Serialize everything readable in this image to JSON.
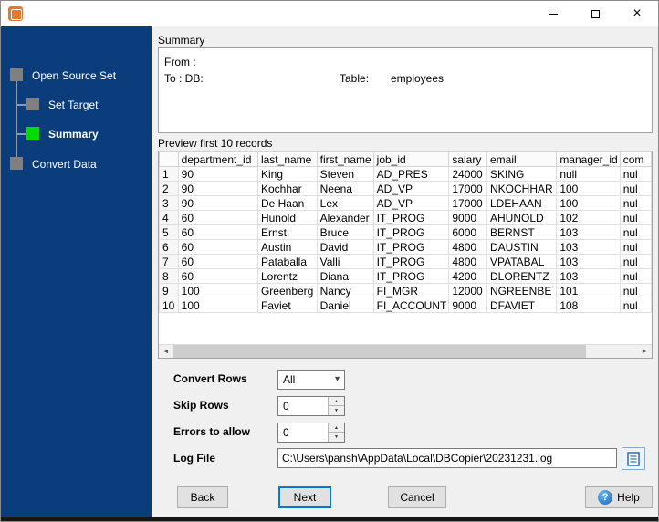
{
  "window": {
    "title": "",
    "icons": {
      "close": "×",
      "help": "?",
      "dropdown_arrow": "▾",
      "spin_up": "▲",
      "spin_down": "▼",
      "scroll_left": "◄",
      "scroll_right": "►"
    }
  },
  "sidebar": {
    "steps": [
      {
        "label": "Open Source Set",
        "state": "done"
      },
      {
        "label": "Set Target",
        "state": "done"
      },
      {
        "label": "Summary",
        "state": "current"
      },
      {
        "label": "Convert Data",
        "state": "pending"
      }
    ]
  },
  "summary": {
    "section_label": "Summary",
    "from_label": "From :",
    "to_label": "To : DB:",
    "table_label": "Table:",
    "table_value": "employees"
  },
  "preview": {
    "section_label": "Preview first 10 records",
    "columns": [
      "",
      "department_id",
      "last_name",
      "first_name",
      "job_id",
      "salary",
      "email",
      "manager_id",
      "com"
    ],
    "rows": [
      [
        "1",
        "90",
        "King",
        "Steven",
        "AD_PRES",
        "24000",
        "SKING",
        "null",
        "nul"
      ],
      [
        "2",
        "90",
        "Kochhar",
        "Neena",
        "AD_VP",
        "17000",
        "NKOCHHAR",
        "100",
        "nul"
      ],
      [
        "3",
        "90",
        "De Haan",
        "Lex",
        "AD_VP",
        "17000",
        "LDEHAAN",
        "100",
        "nul"
      ],
      [
        "4",
        "60",
        "Hunold",
        "Alexander",
        "IT_PROG",
        "9000",
        "AHUNOLD",
        "102",
        "nul"
      ],
      [
        "5",
        "60",
        "Ernst",
        "Bruce",
        "IT_PROG",
        "6000",
        "BERNST",
        "103",
        "nul"
      ],
      [
        "6",
        "60",
        "Austin",
        "David",
        "IT_PROG",
        "4800",
        "DAUSTIN",
        "103",
        "nul"
      ],
      [
        "7",
        "60",
        "Pataballa",
        "Valli",
        "IT_PROG",
        "4800",
        "VPATABAL",
        "103",
        "nul"
      ],
      [
        "8",
        "60",
        "Lorentz",
        "Diana",
        "IT_PROG",
        "4200",
        "DLORENTZ",
        "103",
        "nul"
      ],
      [
        "9",
        "100",
        "Greenberg",
        "Nancy",
        "FI_MGR",
        "12000",
        "NGREENBE",
        "101",
        "nul"
      ],
      [
        "10",
        "100",
        "Faviet",
        "Daniel",
        "FI_ACCOUNT",
        "9000",
        "DFAVIET",
        "108",
        "nul"
      ]
    ]
  },
  "form": {
    "convert_rows": {
      "label": "Convert Rows",
      "value": "All"
    },
    "skip_rows": {
      "label": "Skip Rows",
      "value": "0"
    },
    "errors_to_allow": {
      "label": "Errors to allow",
      "value": "0"
    },
    "log_file": {
      "label": "Log File",
      "value": "C:\\Users\\pansh\\AppData\\Local\\DBCopier\\20231231.log"
    }
  },
  "buttons": {
    "back": "Back",
    "next": "Next",
    "cancel": "Cancel",
    "help": "Help"
  },
  "colors": {
    "sidebar": "#0b3d7c",
    "step_current": "#00dd00",
    "step_other": "#808080",
    "accent": "#0078d7"
  }
}
